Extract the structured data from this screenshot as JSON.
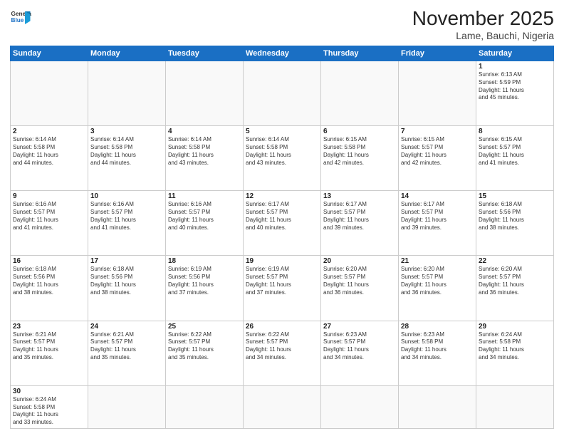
{
  "header": {
    "logo_line1": "General",
    "logo_line2": "Blue",
    "month_title": "November 2025",
    "location": "Lame, Bauchi, Nigeria"
  },
  "days_of_week": [
    "Sunday",
    "Monday",
    "Tuesday",
    "Wednesday",
    "Thursday",
    "Friday",
    "Saturday"
  ],
  "weeks": [
    [
      {
        "day": "",
        "info": ""
      },
      {
        "day": "",
        "info": ""
      },
      {
        "day": "",
        "info": ""
      },
      {
        "day": "",
        "info": ""
      },
      {
        "day": "",
        "info": ""
      },
      {
        "day": "",
        "info": ""
      },
      {
        "day": "1",
        "info": "Sunrise: 6:13 AM\nSunset: 5:59 PM\nDaylight: 11 hours\nand 45 minutes."
      }
    ],
    [
      {
        "day": "2",
        "info": "Sunrise: 6:14 AM\nSunset: 5:58 PM\nDaylight: 11 hours\nand 44 minutes."
      },
      {
        "day": "3",
        "info": "Sunrise: 6:14 AM\nSunset: 5:58 PM\nDaylight: 11 hours\nand 44 minutes."
      },
      {
        "day": "4",
        "info": "Sunrise: 6:14 AM\nSunset: 5:58 PM\nDaylight: 11 hours\nand 43 minutes."
      },
      {
        "day": "5",
        "info": "Sunrise: 6:14 AM\nSunset: 5:58 PM\nDaylight: 11 hours\nand 43 minutes."
      },
      {
        "day": "6",
        "info": "Sunrise: 6:15 AM\nSunset: 5:58 PM\nDaylight: 11 hours\nand 42 minutes."
      },
      {
        "day": "7",
        "info": "Sunrise: 6:15 AM\nSunset: 5:57 PM\nDaylight: 11 hours\nand 42 minutes."
      },
      {
        "day": "8",
        "info": "Sunrise: 6:15 AM\nSunset: 5:57 PM\nDaylight: 11 hours\nand 41 minutes."
      }
    ],
    [
      {
        "day": "9",
        "info": "Sunrise: 6:16 AM\nSunset: 5:57 PM\nDaylight: 11 hours\nand 41 minutes."
      },
      {
        "day": "10",
        "info": "Sunrise: 6:16 AM\nSunset: 5:57 PM\nDaylight: 11 hours\nand 41 minutes."
      },
      {
        "day": "11",
        "info": "Sunrise: 6:16 AM\nSunset: 5:57 PM\nDaylight: 11 hours\nand 40 minutes."
      },
      {
        "day": "12",
        "info": "Sunrise: 6:17 AM\nSunset: 5:57 PM\nDaylight: 11 hours\nand 40 minutes."
      },
      {
        "day": "13",
        "info": "Sunrise: 6:17 AM\nSunset: 5:57 PM\nDaylight: 11 hours\nand 39 minutes."
      },
      {
        "day": "14",
        "info": "Sunrise: 6:17 AM\nSunset: 5:57 PM\nDaylight: 11 hours\nand 39 minutes."
      },
      {
        "day": "15",
        "info": "Sunrise: 6:18 AM\nSunset: 5:56 PM\nDaylight: 11 hours\nand 38 minutes."
      }
    ],
    [
      {
        "day": "16",
        "info": "Sunrise: 6:18 AM\nSunset: 5:56 PM\nDaylight: 11 hours\nand 38 minutes."
      },
      {
        "day": "17",
        "info": "Sunrise: 6:18 AM\nSunset: 5:56 PM\nDaylight: 11 hours\nand 38 minutes."
      },
      {
        "day": "18",
        "info": "Sunrise: 6:19 AM\nSunset: 5:56 PM\nDaylight: 11 hours\nand 37 minutes."
      },
      {
        "day": "19",
        "info": "Sunrise: 6:19 AM\nSunset: 5:57 PM\nDaylight: 11 hours\nand 37 minutes."
      },
      {
        "day": "20",
        "info": "Sunrise: 6:20 AM\nSunset: 5:57 PM\nDaylight: 11 hours\nand 36 minutes."
      },
      {
        "day": "21",
        "info": "Sunrise: 6:20 AM\nSunset: 5:57 PM\nDaylight: 11 hours\nand 36 minutes."
      },
      {
        "day": "22",
        "info": "Sunrise: 6:20 AM\nSunset: 5:57 PM\nDaylight: 11 hours\nand 36 minutes."
      }
    ],
    [
      {
        "day": "23",
        "info": "Sunrise: 6:21 AM\nSunset: 5:57 PM\nDaylight: 11 hours\nand 35 minutes."
      },
      {
        "day": "24",
        "info": "Sunrise: 6:21 AM\nSunset: 5:57 PM\nDaylight: 11 hours\nand 35 minutes."
      },
      {
        "day": "25",
        "info": "Sunrise: 6:22 AM\nSunset: 5:57 PM\nDaylight: 11 hours\nand 35 minutes."
      },
      {
        "day": "26",
        "info": "Sunrise: 6:22 AM\nSunset: 5:57 PM\nDaylight: 11 hours\nand 34 minutes."
      },
      {
        "day": "27",
        "info": "Sunrise: 6:23 AM\nSunset: 5:57 PM\nDaylight: 11 hours\nand 34 minutes."
      },
      {
        "day": "28",
        "info": "Sunrise: 6:23 AM\nSunset: 5:58 PM\nDaylight: 11 hours\nand 34 minutes."
      },
      {
        "day": "29",
        "info": "Sunrise: 6:24 AM\nSunset: 5:58 PM\nDaylight: 11 hours\nand 34 minutes."
      }
    ],
    [
      {
        "day": "30",
        "info": "Sunrise: 6:24 AM\nSunset: 5:58 PM\nDaylight: 11 hours\nand 33 minutes."
      },
      {
        "day": "",
        "info": ""
      },
      {
        "day": "",
        "info": ""
      },
      {
        "day": "",
        "info": ""
      },
      {
        "day": "",
        "info": ""
      },
      {
        "day": "",
        "info": ""
      },
      {
        "day": "",
        "info": ""
      }
    ]
  ]
}
